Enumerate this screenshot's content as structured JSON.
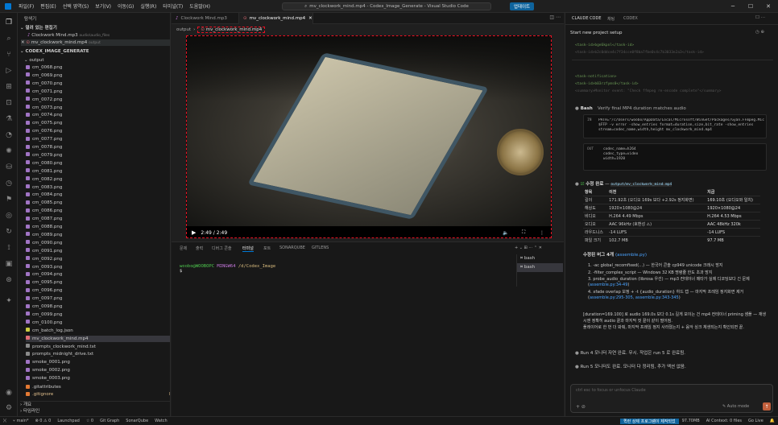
{
  "titlebar": {
    "menus": [
      "파일(F)",
      "편집(E)",
      "선택 영역(S)",
      "보기(V)",
      "이동(G)",
      "실행(R)",
      "터미널(T)",
      "도움말(H)"
    ],
    "window_title": "mv_clockwork_mind.mp4 - Codex_Image_Generate - Visual Studio Code",
    "update_button": "업데이트"
  },
  "sidebar": {
    "header": "탐색기",
    "open_editors_label": "열려 있는 편집기",
    "open_editors": [
      {
        "name": "Clockwork Mind.mp3",
        "hint": "audio\\audio_files"
      },
      {
        "name": "mv_clockwork_mind.mp4",
        "hint": "output"
      }
    ],
    "project": "CODEX_IMAGE_GENERATE",
    "folder": "output",
    "files": [
      "cm_0068.png",
      "cm_0069.png",
      "cm_0070.png",
      "cm_0071.png",
      "cm_0072.png",
      "cm_0073.png",
      "cm_0074.png",
      "cm_0075.png",
      "cm_0076.png",
      "cm_0077.png",
      "cm_0078.png",
      "cm_0079.png",
      "cm_0080.png",
      "cm_0081.png",
      "cm_0082.png",
      "cm_0083.png",
      "cm_0084.png",
      "cm_0085.png",
      "cm_0086.png",
      "cm_0087.png",
      "cm_0088.png",
      "cm_0089.png",
      "cm_0090.png",
      "cm_0091.png",
      "cm_0092.png",
      "cm_0093.png",
      "cm_0094.png",
      "cm_0095.png",
      "cm_0096.png",
      "cm_0097.png",
      "cm_0098.png",
      "cm_0099.png",
      "cm_0100.png",
      "cm_batch_log.json",
      "mv_clockwork_mind.mp4",
      "prompts_clockwork_mind.txt",
      "prompts_midnight_drive.txt",
      "smoke_0001.png",
      "smoke_0002.png",
      "smoke_0003.png"
    ],
    "gitattributes": ".gitattributes",
    "gitignore": ".gitignore",
    "gitignore_status": "M",
    "outline": "개요",
    "timeline": "타임라인"
  },
  "editor": {
    "tabs": [
      "Clockwork Mind.mp3",
      "mv_clockwork_mind.mp4"
    ],
    "breadcrumb": [
      "output",
      "mv_clockwork_mind.mp4"
    ],
    "video_time": "2:49 / 2:49"
  },
  "panel": {
    "tabs": [
      "문제",
      "출력",
      "디버그 콘솔",
      "터미널",
      "포트",
      "SONARQUBE",
      "GITLENS"
    ],
    "prompt_user": "woobo@WOOBOPC",
    "prompt_env": "MINGW64",
    "prompt_path": "/d/Codex_Image",
    "prompt_symbol": "$",
    "terminals": [
      "bash",
      "bash"
    ]
  },
  "chat": {
    "tabs": [
      "CLAUDE CODE",
      "채팅",
      "CODEX"
    ],
    "title": "Start new project setup",
    "task_id_line": "<task-id>bge6kpnl</task-id>",
    "task_line2": "<task-id>b2c0ddce4c7f34cce0f8ba7fbe0c4c7b3033e2a3</task-id>",
    "notif_open": "<task-notification>",
    "notif_id": "<task-id>b03rzfyms0</task-id>",
    "notif_note": "<summary>Monitor event: \"Check ffmpeg re-encode complete\"</summary>",
    "bash_label": "Bash",
    "bash_desc": "Verify final MP4 duration matches audio",
    "in_label": "IN",
    "in_code": "PATH=\"/c/Users/woobo/AppData/Local/Microsoft/WinGet/Packages/Gyan.FFmpeg.Micro\" $FFP -v error -show_entries format=duration,size,bit_rate -show_entries stream=codec_name,width,height mv_clockwork_mind.mp4",
    "out_label": "OUT",
    "out_code": [
      "codec_name=h264",
      "codec_type=video",
      "width=1920"
    ],
    "done_label": "수정 완료",
    "done_path": "output/mv_clockwork_mind.mp4",
    "table_headers": [
      "항목",
      "이전",
      "지금"
    ],
    "table_rows": [
      [
        "길이",
        "171.92초 (오디오 169s 보다 +2.92s 정지화면)",
        "169.10초 (오디오와 일치)"
      ],
      [
        "해상도",
        "1920×1080@24",
        "1920×1080@24"
      ],
      [
        "비디오",
        "H.264 4.49 Mbps",
        "H.264 4.53 Mbps"
      ],
      [
        "오디오",
        "AAC 96kHz (호환성 ⚠)",
        "AAC 48kHz 320k"
      ],
      [
        "라우드니스",
        "-14 LUFS",
        "-14 LUFS"
      ],
      [
        "파일 크기",
        "102.7 MB",
        "97.7 MB"
      ]
    ],
    "fixes_title": "수정된 버그 4개",
    "fixes_link": "(assemble.py)",
    "fixes": [
      "-ac global_recomfixed(…) — 한국어 콘솔 cp949 unicode 크래시 방지",
      "-filter_complex_script — Windows 32 KB 명령줄 한도 초과 방지",
      "probe_audio_duration (librosa 우선) — mp3 컨테이너 메타가 실제 디코딩보다 긴 문제",
      "xfade overlap 보정 + -t {audio_duration} 하드 캡 — 마지막 프레임 정지화면 제거"
    ],
    "fix_links": [
      "assemble.py:34-49",
      "assemble.py:295-305, assemble.py:343-345"
    ],
    "para1": "[duration=169.100] 로 audio 169.0s 보다 0.1s 길게 보이는 건 mp4 컨테이너 priming 샘플 — 재생 시엔 정확히 audio 끝과 마지막 컷 끝이 같이 떨어짐.",
    "para2": "플레이어로 한 번 더 봐줘, 마지막 프레임 정지 사라졌는지 + 음악 싱크 체생되는지 확인되면 끝.",
    "run4": "Run 4 모니터 자연 완료. 무시. 작업은 run 5 로 완료됨.",
    "run5": "Run 5 모니터도 완료. 모니터 다 정리됨, 추가 액션 없음.",
    "input_placeholder": "ctrl esc to focus or unfocus Claude",
    "auto_mode": "Auto mode"
  },
  "statusbar": {
    "items": [
      "main*",
      "⊗ 0 ⚠ 0",
      "Launchpad",
      "☆ 0",
      "Git Graph",
      "SonarQube",
      "Watch"
    ],
    "right_items": [
      "퀵런 상제 프로그램이 제작되었",
      "97.70MB",
      "AI Context: 0 files",
      "Go Live"
    ]
  }
}
